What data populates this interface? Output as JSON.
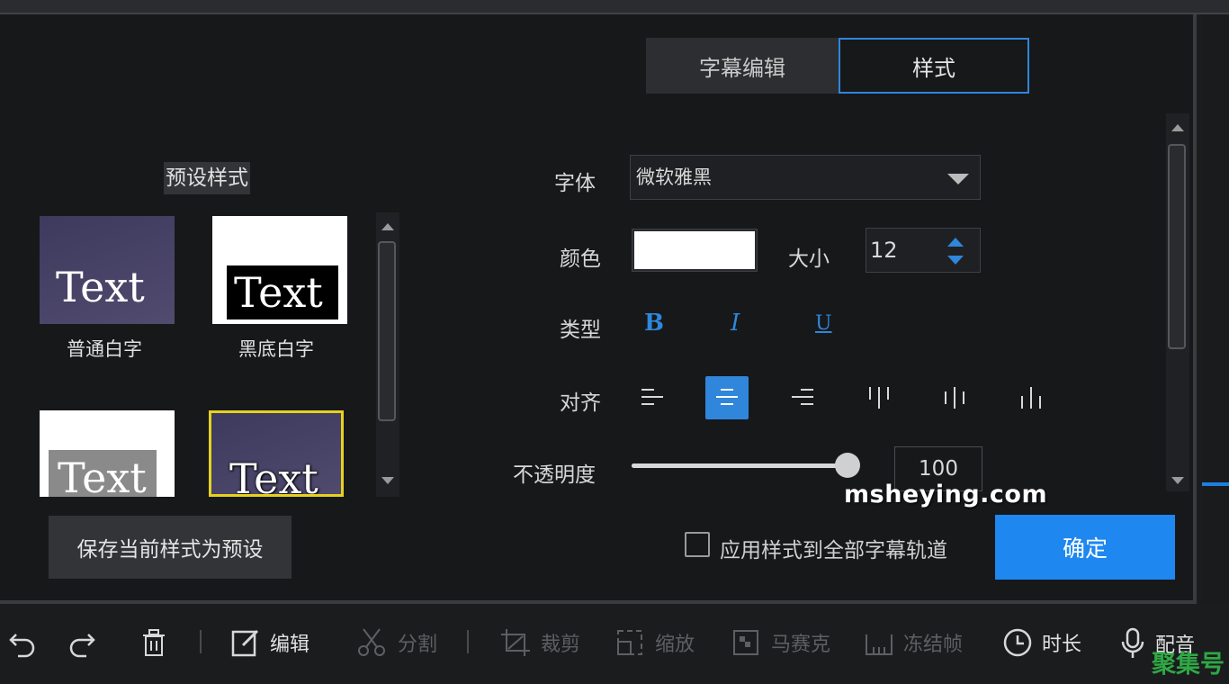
{
  "tabs": [
    "字幕编辑",
    "样式"
  ],
  "presets": {
    "title": "预设样式",
    "items": [
      {
        "label": "普通白字",
        "sample": "Text"
      },
      {
        "label": "黑底白字",
        "sample": "Text"
      },
      {
        "label": "",
        "sample": "Text"
      },
      {
        "label": "",
        "sample": "Text"
      }
    ],
    "save_label": "保存当前样式为预设"
  },
  "style": {
    "font_label": "字体",
    "font_value": "微软雅黑",
    "color_label": "颜色",
    "color_value": "#ffffff",
    "size_label": "大小",
    "size_value": "12",
    "type_label": "类型",
    "type_buttons": [
      "B",
      "I",
      "U"
    ],
    "align_label": "对齐",
    "align_icons": [
      "align-left-icon",
      "align-center-icon",
      "align-right-icon",
      "align-top-icon",
      "align-middle-icon",
      "align-bottom-icon"
    ],
    "align_selected": "align-center-icon",
    "opacity_label": "不透明度",
    "opacity_value": "100",
    "opacity_fraction": 1.0
  },
  "apply_all_label": "应用样式到全部字幕轨道",
  "confirm_label": "确定",
  "watermark": "msheying.com",
  "toolbar": {
    "undo": "undo-icon",
    "redo": "redo-icon",
    "delete": "trash-icon",
    "edit": "编辑",
    "split": "分割",
    "crop": "裁剪",
    "zoom": "缩放",
    "mosaic": "马赛克",
    "freeze": "冻结帧",
    "duration": "时长",
    "dub": "配音"
  },
  "brand": "聚集号",
  "colors": {
    "accent": "#1e87f0",
    "highlight_border": "#e6d21e"
  }
}
